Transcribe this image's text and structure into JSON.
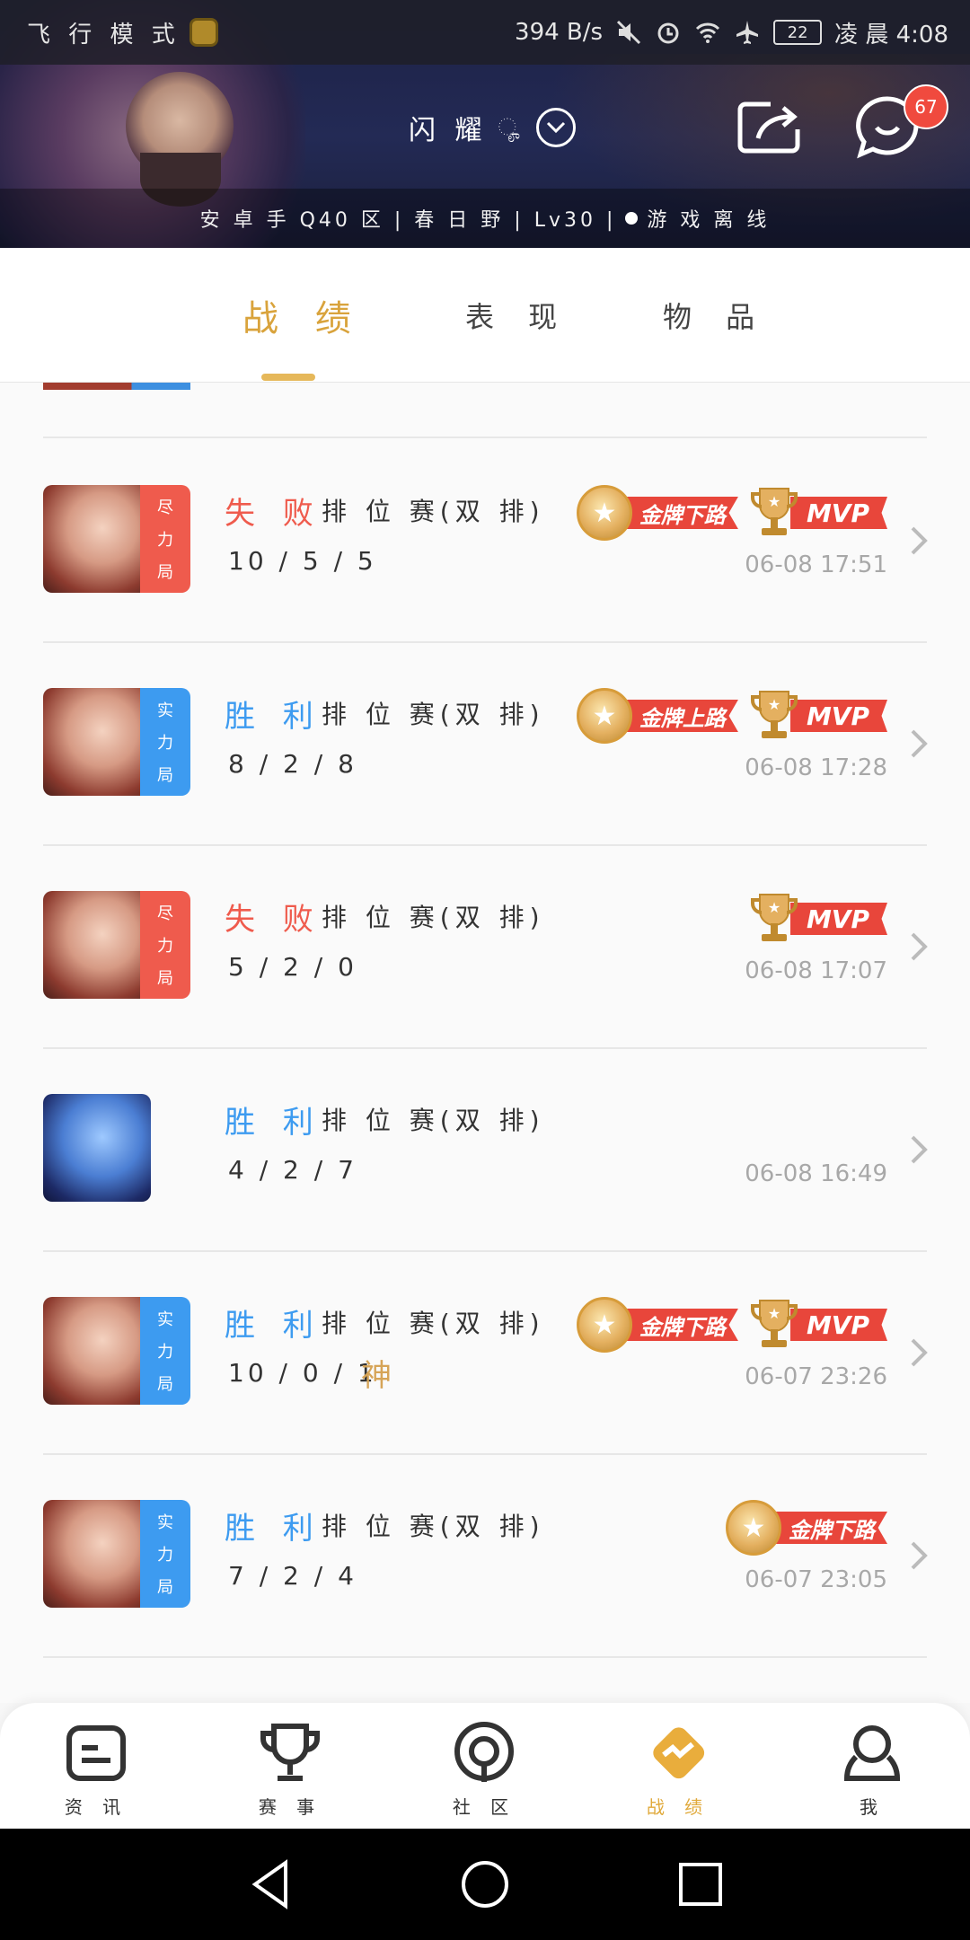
{
  "status_bar": {
    "left_text": "飞 行 模 式",
    "network_speed": "394 B/s",
    "battery": "22",
    "time": "凌 晨 4:08"
  },
  "header": {
    "profile_name": "闪 耀",
    "message_count": "67",
    "server_info": "安 卓 手 Q40 区 | 春 日 野 | Lv30 |",
    "status": "游 戏 离 线"
  },
  "tabs": [
    {
      "label": "战 绩",
      "active": true
    },
    {
      "label": "表 现",
      "active": false
    },
    {
      "label": "物 品",
      "active": false
    }
  ],
  "matches": [
    {
      "result": "失 败",
      "result_type": "loss",
      "tag": [
        "尽",
        "力",
        "局"
      ],
      "tag_color": "red",
      "avatar": "hero-a",
      "mode": "排 位 赛(双 排)",
      "kda": "10 / 5 / 5",
      "god": "",
      "medal": "金牌下路",
      "mvp": "MVP",
      "time": "06-08 17:51"
    },
    {
      "result": "胜 利",
      "result_type": "win",
      "tag": [
        "实",
        "力",
        "局"
      ],
      "tag_color": "blue",
      "avatar": "hero-a",
      "mode": "排 位 赛(双 排)",
      "kda": "8 / 2 / 8",
      "god": "",
      "medal": "金牌上路",
      "mvp": "MVP",
      "time": "06-08 17:28"
    },
    {
      "result": "失 败",
      "result_type": "loss",
      "tag": [
        "尽",
        "力",
        "局"
      ],
      "tag_color": "red",
      "avatar": "hero-a",
      "mode": "排 位 赛(双 排)",
      "kda": "5 / 2 / 0",
      "god": "",
      "medal": "",
      "mvp": "MVP",
      "time": "06-08 17:07"
    },
    {
      "result": "胜 利",
      "result_type": "win",
      "tag": [],
      "tag_color": "",
      "avatar": "hero-b",
      "mode": "排 位 赛(双 排)",
      "kda": "4 / 2 / 7",
      "god": "",
      "medal": "",
      "mvp": "",
      "time": "06-08 16:49"
    },
    {
      "result": "胜 利",
      "result_type": "win",
      "tag": [
        "实",
        "力",
        "局"
      ],
      "tag_color": "blue",
      "avatar": "hero-a",
      "mode": "排 位 赛(双 排)",
      "kda": "10 / 0 / 1",
      "god": "神",
      "medal": "金牌下路",
      "mvp": "MVP",
      "time": "06-07 23:26"
    },
    {
      "result": "胜 利",
      "result_type": "win",
      "tag": [
        "实",
        "力",
        "局"
      ],
      "tag_color": "blue",
      "avatar": "hero-a",
      "mode": "排 位 赛(双 排)",
      "kda": "7 / 2 / 4",
      "god": "",
      "medal": "金牌下路",
      "mvp": "",
      "time": "06-07 23:05"
    }
  ],
  "bottom_nav": [
    {
      "label": "资 讯",
      "icon": "news-icon",
      "active": false
    },
    {
      "label": "赛 事",
      "icon": "trophy-icon",
      "active": false
    },
    {
      "label": "社 区",
      "icon": "community-icon",
      "active": false
    },
    {
      "label": "战 绩",
      "icon": "record-icon",
      "active": true
    },
    {
      "label": "我",
      "icon": "profile-icon",
      "active": false
    }
  ],
  "colors": {
    "accent": "#d9a33c",
    "win": "#3d9bf0",
    "loss": "#ef5b4d",
    "ribbon": "#e8463b"
  }
}
